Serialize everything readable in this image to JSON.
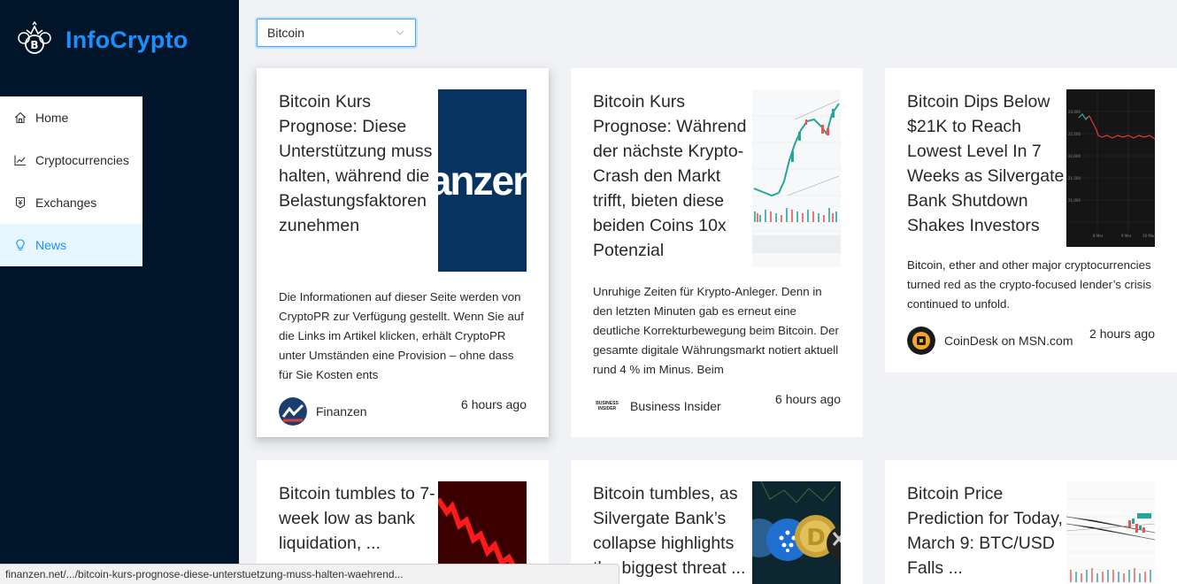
{
  "app": {
    "name": "InfoCrypto",
    "accent": "#1890ff",
    "sidebar_bg": "#001529"
  },
  "menu": [
    {
      "label": "Home",
      "icon": "home-icon",
      "active": false
    },
    {
      "label": "Cryptocurrencies",
      "icon": "line-chart-icon",
      "active": false
    },
    {
      "label": "Exchanges",
      "icon": "money-collect-icon",
      "active": false
    },
    {
      "label": "News",
      "icon": "bulb-icon",
      "active": true
    }
  ],
  "filter": {
    "selected": "Bitcoin"
  },
  "news": [
    {
      "title": "Bitcoin Kurs Prognose: Diese Unterstützung muss halten, während die Belastungsfaktoren zunehmen",
      "image_text": "anzen",
      "description": "Die Informationen auf dieser Seite werden von CryptoPR zur Verfügung gestellt. Wenn Sie auf die Links im Artikel klicken, erhält CryptoPR unter Umständen eine Provision – ohne dass für Sie Kosten ents",
      "provider": "Finanzen",
      "time": "6 hours ago"
    },
    {
      "title": "Bitcoin Kurs Prognose: Während der nächste Krypto-Crash den Markt trifft, bieten diese beiden Coins 10x Potenzial",
      "description": "Unruhige Zeiten für Krypto-Anleger. Denn in den letzten Minuten gab es erneut eine deutliche Korrekturbewegung beim Bitcoin. Der gesamte digitale Währungsmarkt notiert aktuell rund 4 % im Minus. Beim",
      "provider": "Business Insider",
      "provider_logo_text": "BUSINESS INSIDER",
      "time": "6 hours ago"
    },
    {
      "title": "Bitcoin Dips Below $21K to Reach Lowest Level In 7 Weeks as Silvergate Bank Shutdown Shakes Investors",
      "description": "Bitcoin, ether and other major cryptocurrencies turned red as the crypto-focused lender’s crisis continued to unfold.",
      "provider": "CoinDesk on MSN.com",
      "time": "2 hours ago"
    },
    {
      "title": "Bitcoin tumbles to 7-week low as bank liquidation, ..."
    },
    {
      "title": "Bitcoin tumbles, as Silvergate Bank’s collapse highlights the biggest threat ..."
    },
    {
      "title": "Bitcoin Price Prediction for Today, March 9: BTC/USD Falls ..."
    }
  ],
  "status_url": "finanzen.net/.../bitcoin-kurs-prognose-diese-unterstuetzung-muss-halten-waehrend..."
}
